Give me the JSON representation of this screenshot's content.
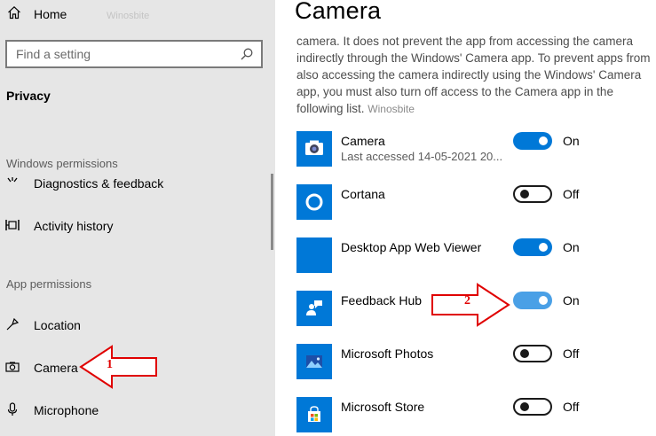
{
  "sidebar": {
    "home_label": "Home",
    "watermark": "Winosbite",
    "search": {
      "placeholder": "Find a setting"
    },
    "section_title": "Privacy",
    "windows_permissions_header": "Windows permissions",
    "windows_items": [
      {
        "label": "Diagnostics & feedback",
        "icon": "diagnostics-icon"
      },
      {
        "label": "Activity history",
        "icon": "activity-history-icon"
      }
    ],
    "app_permissions_header": "App permissions",
    "app_items": [
      {
        "label": "Location",
        "icon": "location-icon"
      },
      {
        "label": "Camera",
        "icon": "camera-icon",
        "selected": true
      },
      {
        "label": "Microphone",
        "icon": "microphone-icon"
      }
    ]
  },
  "main": {
    "title": "Camera",
    "description": "camera. It does not prevent the app from accessing the camera indirectly through the Windows' Camera app. To prevent apps from also accessing the camera indirectly using the Windows' Camera app, you must also turn off access to the Camera app in the following list.",
    "description_watermark": "Winosbite",
    "apps": [
      {
        "name": "Camera",
        "subtitle": "Last accessed 14-05-2021 20...",
        "state": "On",
        "icon": "camera-app-icon"
      },
      {
        "name": "Cortana",
        "state": "Off",
        "icon": "cortana-icon"
      },
      {
        "name": "Desktop App Web Viewer",
        "state": "On",
        "icon": "web-viewer-icon"
      },
      {
        "name": "Feedback Hub",
        "state": "On",
        "icon": "feedback-hub-icon"
      },
      {
        "name": "Microsoft Photos",
        "state": "Off",
        "icon": "photos-icon"
      },
      {
        "name": "Microsoft Store",
        "state": "Off",
        "icon": "store-icon"
      }
    ]
  },
  "annotations": {
    "arrow_1": "1",
    "arrow_2": "2"
  },
  "colors": {
    "accent": "#0078d7",
    "sidebar_bg": "#e6e6e6",
    "annotation": "#e00000"
  }
}
